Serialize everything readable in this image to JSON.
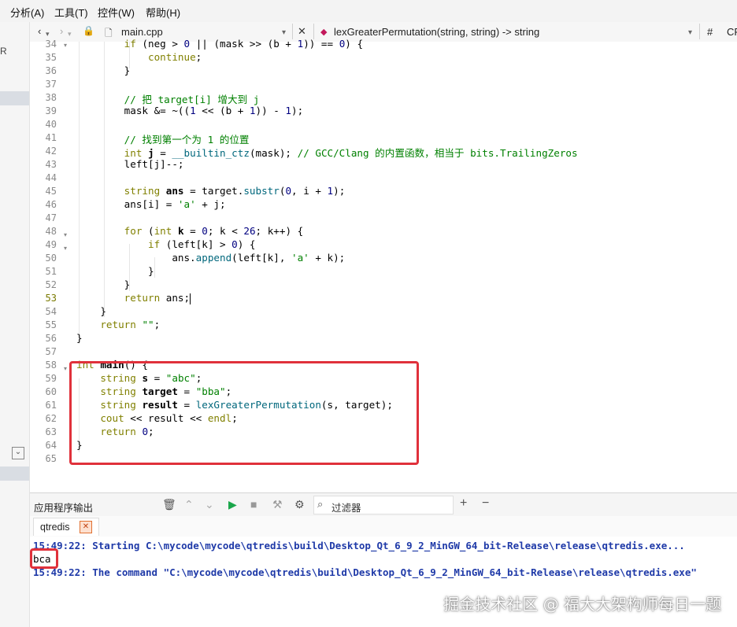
{
  "menubar": {
    "items": [
      "分析(A)",
      "工具(T)",
      "控件(W)",
      "帮助(H)"
    ]
  },
  "left_strip": {
    "top_glyph": "R"
  },
  "toolbar": {
    "file_name": "main.cpp",
    "function_signature": "lexGreaterPermutation(string, string) -> string",
    "hash_label": "#",
    "right_label": "CR"
  },
  "editor": {
    "line_numbers": [
      "34",
      "35",
      "36",
      "37",
      "38",
      "39",
      "40",
      "41",
      "42",
      "43",
      "44",
      "45",
      "46",
      "47",
      "48",
      "49",
      "50",
      "51",
      "52",
      "53",
      "54",
      "55",
      "56",
      "57",
      "58",
      "59",
      "60",
      "61",
      "62",
      "63",
      "64",
      "65"
    ],
    "current_line": "53"
  },
  "output_panel": {
    "title": "应用程序输出",
    "filter_placeholder": "过滤器",
    "tab_label": "qtredis",
    "lines": [
      "15:49:22: Starting C:\\mycode\\mycode\\qtredis\\build\\Desktop_Qt_6_9_2_MinGW_64_bit-Release\\release\\qtredis.exe...",
      "bca",
      "15:49:22: The command \"C:\\mycode\\mycode\\qtredis\\build\\Desktop_Qt_6_9_2_MinGW_64_bit-Release\\release\\qtredis.exe\""
    ]
  },
  "watermark": "掘金技术社区 @ 福大大架构师每日一题",
  "colors": {
    "highlight_box": "#e0313b",
    "run_button": "#1aa64a",
    "output_link": "#1f3aa8"
  }
}
